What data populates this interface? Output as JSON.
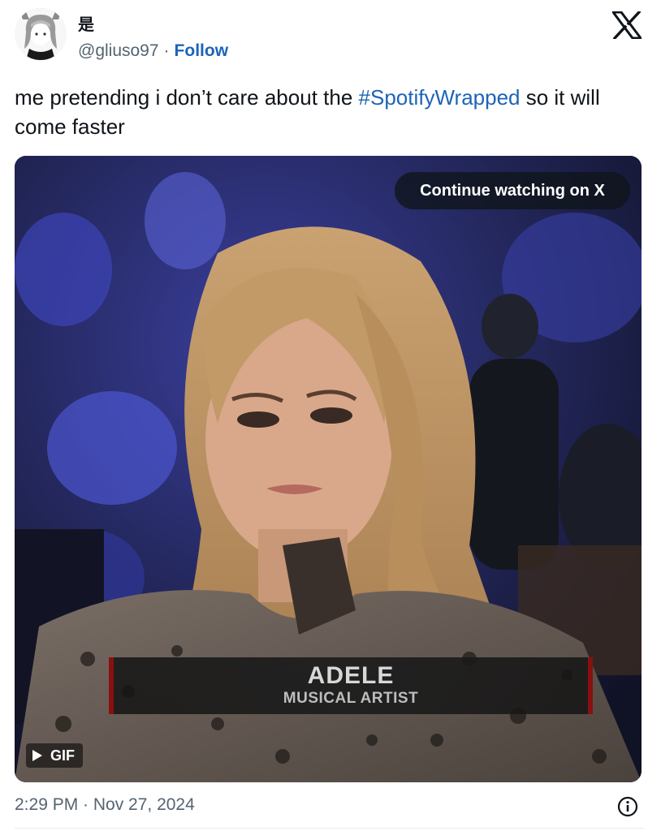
{
  "author": {
    "display_name": "是",
    "handle": "@gliuso97",
    "separator": "·",
    "follow_label": "Follow"
  },
  "tweet": {
    "text_before": "me pretending i don’t care about the ",
    "hashtag": "#SpotifyWrapped",
    "text_after": " so it will come faster"
  },
  "media": {
    "continue_label": "Continue watching on X",
    "gif_label": "GIF",
    "caption_name": "ADELE",
    "caption_title": "MUSICAL ARTIST"
  },
  "footer": {
    "timestamp": "2:29 PM · Nov 27, 2024"
  },
  "icons": {
    "logo": "x-logo-icon",
    "info": "info-icon",
    "play": "play-icon"
  },
  "colors": {
    "link": "#1d64b6",
    "muted": "#536471",
    "text": "#0f1419"
  }
}
